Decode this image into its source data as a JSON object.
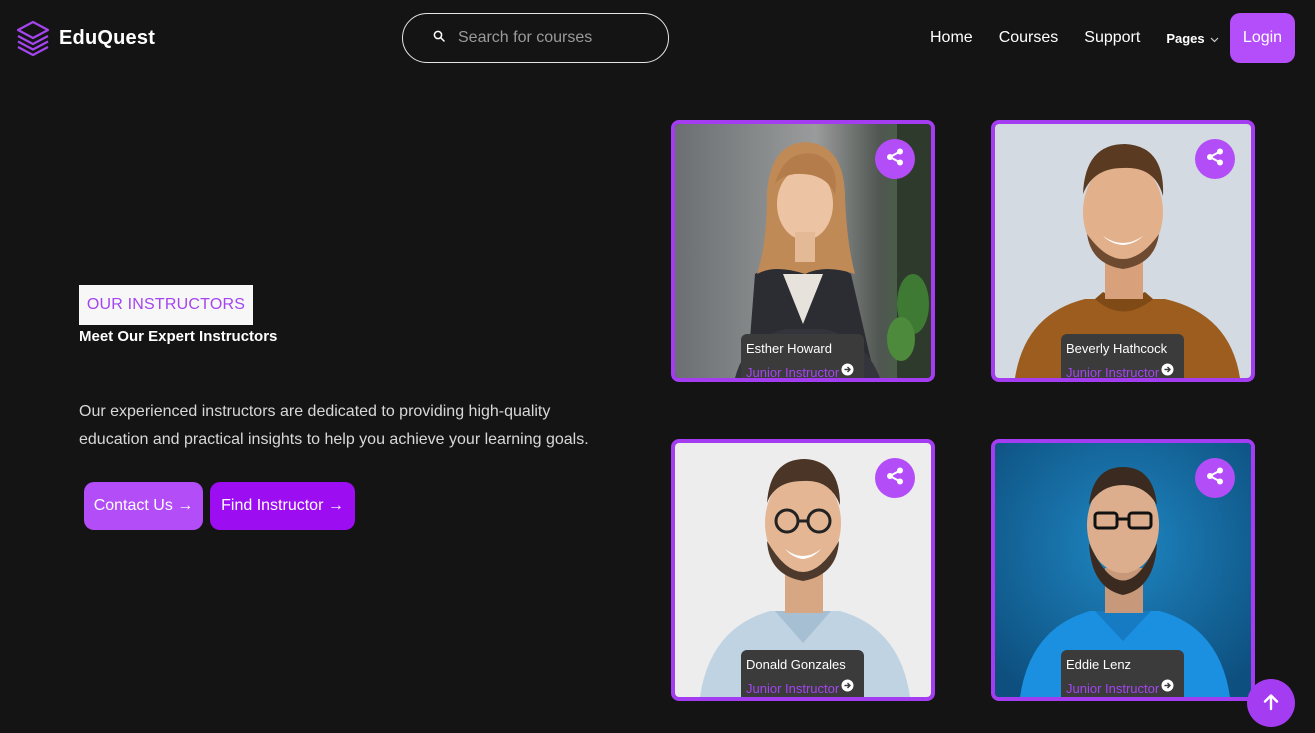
{
  "header": {
    "brand": "EduQuest",
    "search_placeholder": "Search for courses",
    "nav": {
      "home": "Home",
      "courses": "Courses",
      "support": "Support",
      "pages": "Pages"
    },
    "login_label": "Login"
  },
  "hero": {
    "tag": "OUR INSTRUCTORS",
    "heading": "Meet Our Expert Instructors",
    "description": "Our experienced instructors are dedicated to providing high-quality education and practical insights to help you achieve your learning goals.",
    "contact_label": "Contact Us →",
    "find_label": "Find Instructor →"
  },
  "instructors": [
    {
      "name": "Esther Howard",
      "role": "Junior Instructor"
    },
    {
      "name": "Beverly Hathcock",
      "role": "Junior Instructor"
    },
    {
      "name": "Donald Gonzales",
      "role": "Junior Instructor"
    },
    {
      "name": "Eddie Lenz",
      "role": "Junior Instructor"
    }
  ],
  "colors": {
    "background": "#141414",
    "accent": "#b34df7",
    "accent_dark": "#9c0df2",
    "card_border": "#a43cf2",
    "role_text": "#a445f0",
    "info_bg": "#3b3b3b"
  },
  "icons": {
    "logo": "layers-icon",
    "search": "search-icon",
    "dropdown": "chevron-down-icon",
    "share": "share-icon",
    "role_link": "arrow-right-circle-icon",
    "scroll_top": "arrow-up-icon"
  }
}
